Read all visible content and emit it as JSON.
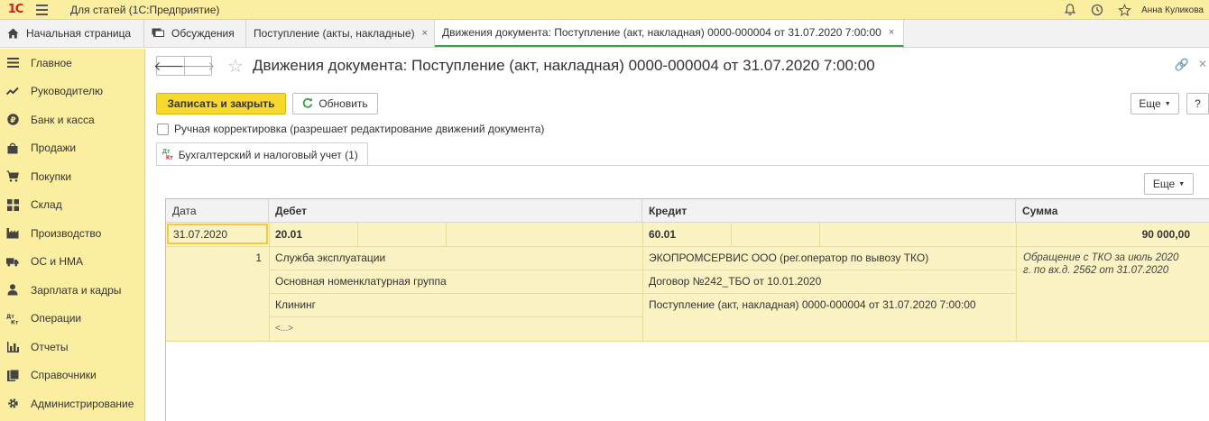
{
  "window": {
    "logo_text": "1С",
    "app_title": "Для статей  (1С:Предприятие)",
    "user_name": "Анна Куликова"
  },
  "tabs": [
    {
      "label": "Начальная страница",
      "icon": "home-icon"
    },
    {
      "label": "Обсуждения",
      "icon": "chat-icon"
    },
    {
      "label": "Поступление (акты, накладные)",
      "close": "×"
    },
    {
      "label": "Движения документа: Поступление (акт, накладная) 0000-000004 от 31.07.2020 7:00:00",
      "close": "×",
      "active": true
    }
  ],
  "sidebar": {
    "items": [
      {
        "label": "Главное",
        "icon": "menu-lines-icon"
      },
      {
        "label": "Руководителю",
        "icon": "trend-icon"
      },
      {
        "label": "Банк и касса",
        "icon": "ruble-coin-icon"
      },
      {
        "label": "Продажи",
        "icon": "shopping-bag-icon"
      },
      {
        "label": "Покупки",
        "icon": "cart-icon"
      },
      {
        "label": "Склад",
        "icon": "warehouse-grid-icon"
      },
      {
        "label": "Производство",
        "icon": "factory-icon"
      },
      {
        "label": "ОС и НМА",
        "icon": "truck-icon"
      },
      {
        "label": "Зарплата и кадры",
        "icon": "person-icon"
      },
      {
        "label": "Операции",
        "icon": "dt-kt-icon"
      },
      {
        "label": "Отчеты",
        "icon": "bar-chart-icon"
      },
      {
        "label": "Справочники",
        "icon": "books-icon"
      },
      {
        "label": "Администрирование",
        "icon": "gear-icon"
      }
    ]
  },
  "form": {
    "title": "Движения документа: Поступление (акт, накладная) 0000-000004 от 31.07.2020 7:00:00",
    "save_close_label": "Записать и закрыть",
    "refresh_label": "Обновить",
    "more_label": "Еще",
    "help_label": "?",
    "manual_edit_label": "Ручная корректировка (разрешает редактирование движений документа)",
    "manual_edit_checked": false,
    "section_tab_label": "Бухгалтерский и налоговый учет (1)",
    "section_tab_icon": "dt-kt-icon",
    "table_more_label": "Еще"
  },
  "table": {
    "columns": [
      "Дата",
      "Дебет",
      "Кредит",
      "Сумма"
    ],
    "row": {
      "date": "31.07.2020",
      "num": "1",
      "debit_account": "20.01",
      "debit_subconto": [
        "Служба эксплуатации",
        "Основная номенклатурная группа",
        "Клининг",
        "<...>"
      ],
      "credit_account": "60.01",
      "credit_subconto": [
        "ЭКОПРОМСЕРВИС ООО (рег.оператор по вывозу ТКО)",
        "Договор №242_ТБО от 10.01.2020",
        "Поступление (акт, накладная) 0000-000004 от 31.07.2020 7:00:00"
      ],
      "amount": "90 000,00",
      "content": "Обращение с ТКО за июль 2020 г. по вх.д. 2562 от 31.07.2020"
    }
  }
}
